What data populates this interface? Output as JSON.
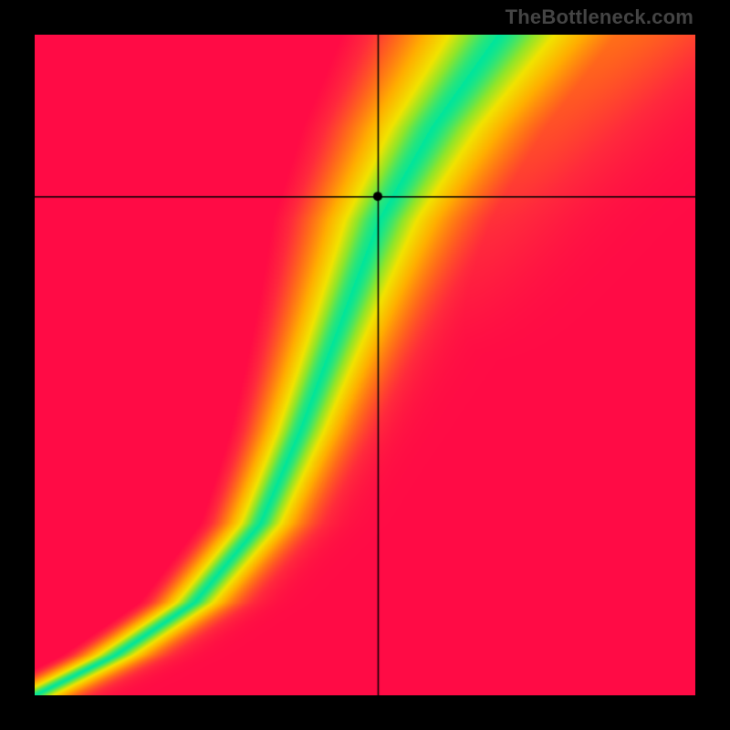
{
  "watermark": "TheBottleneck.com",
  "chart_data": {
    "type": "heatmap",
    "title": "",
    "xlabel": "",
    "ylabel": "",
    "xlim": [
      0,
      1
    ],
    "ylim": [
      0,
      1
    ],
    "crosshair": {
      "x": 0.52,
      "y": 0.755
    },
    "marker": {
      "x": 0.52,
      "y": 0.755,
      "radius": 5
    },
    "ridge_control_points": [
      {
        "x": 0.0,
        "y": 0.0
      },
      {
        "x": 0.12,
        "y": 0.06
      },
      {
        "x": 0.24,
        "y": 0.14
      },
      {
        "x": 0.34,
        "y": 0.26
      },
      {
        "x": 0.4,
        "y": 0.4
      },
      {
        "x": 0.46,
        "y": 0.56
      },
      {
        "x": 0.52,
        "y": 0.72
      },
      {
        "x": 0.6,
        "y": 0.86
      },
      {
        "x": 0.7,
        "y": 1.0
      }
    ],
    "base_band_halfwidth": 0.055,
    "band_widen_top": 0.11,
    "color_stops": [
      {
        "t": 0.0,
        "hex": "#00e59b"
      },
      {
        "t": 0.16,
        "hex": "#8fe52a"
      },
      {
        "t": 0.3,
        "hex": "#f1e300"
      },
      {
        "t": 0.5,
        "hex": "#ffae00"
      },
      {
        "t": 0.7,
        "hex": "#ff6a1a"
      },
      {
        "t": 0.88,
        "hex": "#ff2a3c"
      },
      {
        "t": 1.0,
        "hex": "#ff0b45"
      }
    ],
    "secondary_ridge_offset_x": 0.15,
    "secondary_ridge_strength": 0.32
  }
}
